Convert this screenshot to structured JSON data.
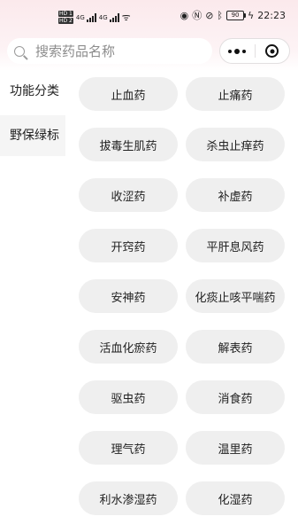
{
  "status_bar": {
    "sim1": "HD 1",
    "sim2": "HD 2",
    "net1": "4G",
    "net2": "4G",
    "battery": "90",
    "time": "22:23"
  },
  "search": {
    "placeholder": "搜索药品名称"
  },
  "sidebar": {
    "items": [
      {
        "label": "功能分类",
        "active": false
      },
      {
        "label": "野保绿标",
        "active": true
      }
    ]
  },
  "categories": [
    "止血药",
    "止痛药",
    "拔毒生肌药",
    "杀虫止痒药",
    "收涩药",
    "补虚药",
    "开窍药",
    "平肝息风药",
    "安神药",
    "化痰止咳平喘药",
    "活血化瘀药",
    "解表药",
    "驱虫药",
    "消食药",
    "理气药",
    "温里药",
    "利水渗湿药",
    "化湿药"
  ],
  "colors": {
    "header_tint": "#fbe9ec",
    "button_bg": "#efefef",
    "sidebar_active_bg": "#f5f5f5"
  }
}
